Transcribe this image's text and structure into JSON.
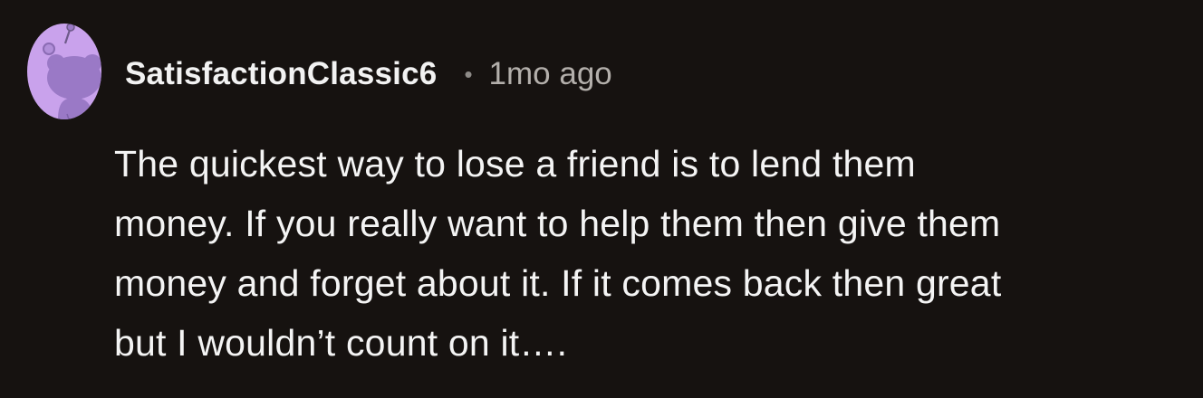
{
  "comment": {
    "author": "SatisfactionClassic6",
    "separator": "•",
    "time_ago": "1mo ago",
    "avatar_icon": "snoo-avatar-icon",
    "text": "The quickest way to lose a friend is to lend them\nmoney. If you really want to help them then give them\nmoney and forget about it. If it comes back then great\nbut I wouldn’t count on it…."
  },
  "colors": {
    "background": "#161210",
    "avatar_bg": "#c9a2ec",
    "avatar_figure": "#9a79c6",
    "username": "#f2f2f2",
    "meta": "#b3afab",
    "text": "#f4f4f4"
  }
}
